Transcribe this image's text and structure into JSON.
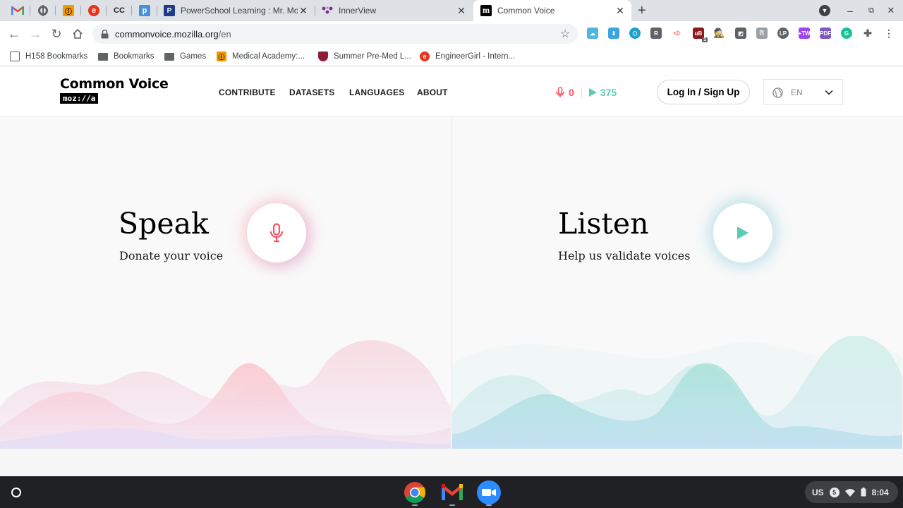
{
  "browser": {
    "pinned_tabs": [
      {
        "icon": "gmail-icon"
      },
      {
        "icon": "globe-icon"
      },
      {
        "icon": "medical-academy-icon"
      },
      {
        "icon": "engineergirl-icon"
      },
      {
        "icon": "cc-icon",
        "text": "CC"
      },
      {
        "icon": "p-icon",
        "text": "p"
      }
    ],
    "tabs": [
      {
        "title": "PowerSchool Learning : Mr. Morc",
        "icon": "powerschool-icon"
      },
      {
        "title": "InnerView",
        "icon": "innerview-icon"
      },
      {
        "title": "Common Voice",
        "icon": "m-icon",
        "active": true
      }
    ],
    "new_tab_label": "+",
    "url_main": "commonvoice.mozilla.org",
    "url_path": "/en",
    "bookmarks": [
      {
        "label": "H158 Bookmarks",
        "icon": "bookmark-folder-icon"
      },
      {
        "label": "Bookmarks",
        "icon": "folder-icon"
      },
      {
        "label": "Games",
        "icon": "folder-icon"
      },
      {
        "label": "Medical Academy:...",
        "icon": "medical-academy-icon"
      },
      {
        "label": "Summer Pre-Med L...",
        "icon": "shield-icon"
      },
      {
        "label": "EngineerGirl - Intern...",
        "icon": "engineergirl-icon"
      }
    ],
    "extensions": [
      "cloud",
      "download",
      "hex",
      "R",
      "arrow",
      "ublock",
      "spy",
      "reader",
      "copy",
      "lp",
      "tw",
      "pdf",
      "grammarly",
      "puzzle",
      "menu"
    ],
    "ublock_badge": "1"
  },
  "site": {
    "brand": "Common Voice",
    "brand_sub": "moz://a",
    "nav": [
      "CONTRIBUTE",
      "DATASETS",
      "LANGUAGES",
      "ABOUT"
    ],
    "stats": {
      "recorded": "0",
      "validated": "375"
    },
    "login_label": "Log In / Sign Up",
    "language": "EN",
    "speak": {
      "title": "Speak",
      "subtitle": "Donate your voice"
    },
    "listen": {
      "title": "Listen",
      "subtitle": "Help us validate voices"
    },
    "colors": {
      "speak_accent": "#ff4f5e",
      "listen_accent": "#59cbb7"
    }
  },
  "shelf": {
    "apps": [
      "chrome-icon",
      "gmail-icon",
      "zoom-icon"
    ],
    "ime": "US",
    "notification_count": "5",
    "time": "8:04"
  }
}
